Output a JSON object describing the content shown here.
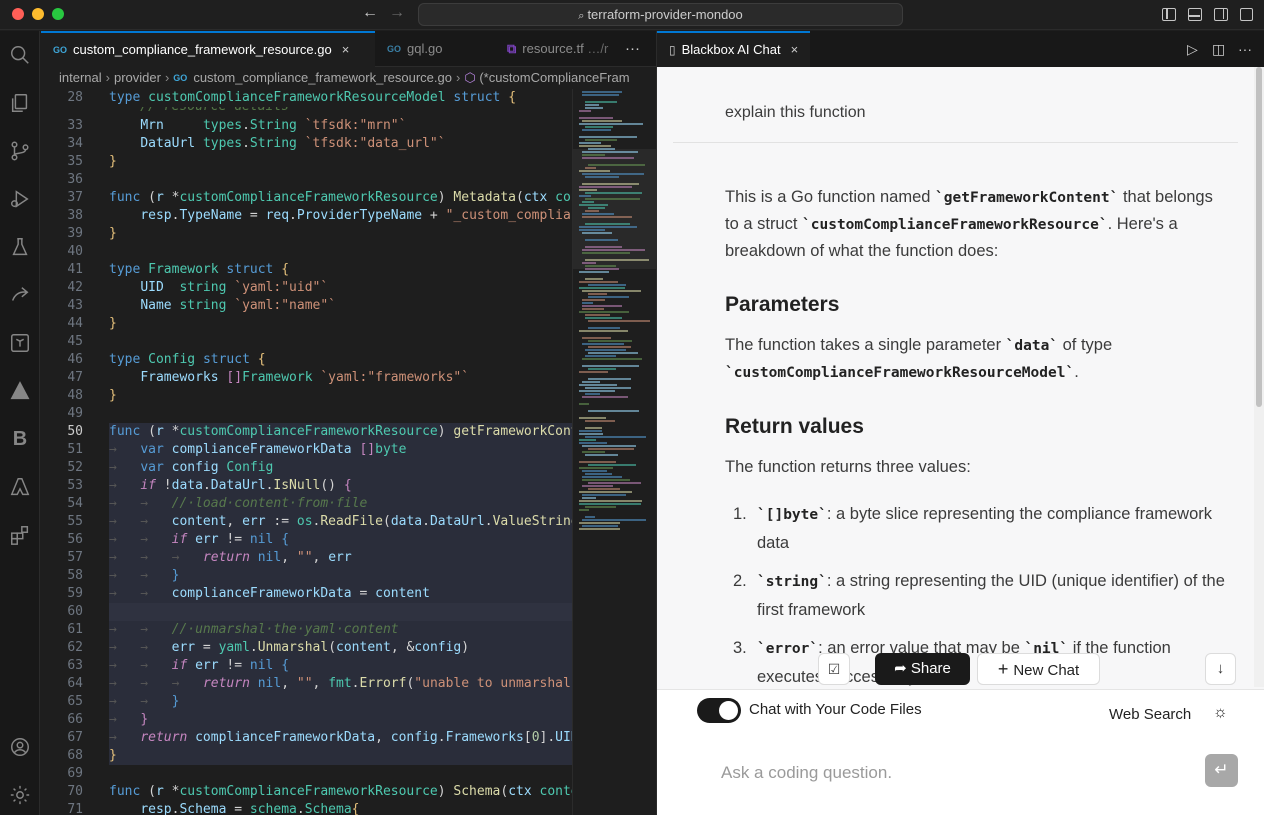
{
  "window": {
    "title": "terraform-provider-mondoo"
  },
  "editor": {
    "tabs": [
      {
        "label": "custom_compliance_framework_resource.go",
        "tag": "GO",
        "active": true
      },
      {
        "label": "gql.go",
        "tag": "GO",
        "active": false
      },
      {
        "label": "resource.tf",
        "suffix": "…/r",
        "active": false
      }
    ],
    "more_label": "···",
    "close_glyph": "×",
    "breadcrumb": {
      "items": [
        "internal",
        "provider",
        "custom_compliance_framework_resource.go"
      ],
      "symbol": "(*customComplianceFram"
    },
    "line_numbers": [
      "28",
      "33",
      "34",
      "35",
      "36",
      "37",
      "38",
      "39",
      "40",
      "41",
      "42",
      "43",
      "44",
      "45",
      "46",
      "47",
      "48",
      "49",
      "50",
      "51",
      "52",
      "53",
      "54",
      "55",
      "56",
      "57",
      "58",
      "59",
      "60",
      "61",
      "62",
      "63",
      "64",
      "65",
      "66",
      "67",
      "68",
      "69",
      "70",
      "71"
    ]
  },
  "chat": {
    "tab_label": "Blackbox AI Chat",
    "user_message": "explain this function",
    "answer": {
      "intro_pre": "This is a Go function named ",
      "intro_fn": "`getFrameworkContent`",
      "intro_mid": " that belongs to a struct ",
      "intro_struct": "`customComplianceFrameworkResource`",
      "intro_post": ". Here's a breakdown of what the function does:",
      "h_params": "Parameters",
      "params_pre": "The function takes a single parameter ",
      "params_code": "`data`",
      "params_mid": " of type ",
      "params_type": "`customComplianceFrameworkResourceModel`",
      "params_post": ".",
      "h_returns": "Return values",
      "returns_text": "The function returns three values:",
      "items": [
        {
          "num": "1.",
          "code": "`[]byte`",
          "text": ": a byte slice representing the compliance framework data"
        },
        {
          "num": "2.",
          "code": "`string`",
          "text": ": a string representing the UID (unique identifier) of the first framework"
        },
        {
          "num": "3.",
          "code": "`error`",
          "text": ": an error value that may be ",
          "code2": "`nil`",
          "text2": " if the function executes successfully"
        }
      ]
    },
    "buttons": {
      "share": "Share",
      "new_chat": "New Chat"
    },
    "toggle_label": "Chat with Your Code Files",
    "toggle_on": true,
    "web_search_label": "Web Search",
    "input_placeholder": "Ask a coding question."
  }
}
